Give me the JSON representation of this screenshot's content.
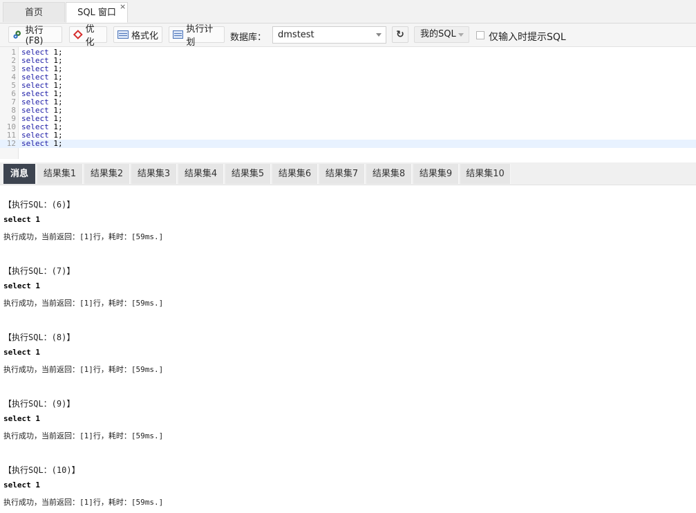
{
  "tabs": {
    "home": "首页",
    "sql": "SQL 窗口",
    "close": "×"
  },
  "toolbar": {
    "execute": "执行(F8)",
    "optimize": "优化",
    "format": "格式化",
    "plan": "执行计划",
    "db_label": "数据库：",
    "db_value": "dmstest",
    "refresh_icon": "↻",
    "my_sql": "我的SQL",
    "hint_only": "仅输入时提示SQL"
  },
  "editor": {
    "lines": [
      {
        "n": "1",
        "kw": "select",
        "rest": " 1;"
      },
      {
        "n": "2",
        "kw": "select",
        "rest": " 1;"
      },
      {
        "n": "3",
        "kw": "select",
        "rest": " 1;"
      },
      {
        "n": "4",
        "kw": "select",
        "rest": " 1;"
      },
      {
        "n": "5",
        "kw": "select",
        "rest": " 1;"
      },
      {
        "n": "6",
        "kw": "select",
        "rest": " 1;"
      },
      {
        "n": "7",
        "kw": "select",
        "rest": " 1;"
      },
      {
        "n": "8",
        "kw": "select",
        "rest": " 1;"
      },
      {
        "n": "9",
        "kw": "select",
        "rest": " 1;"
      },
      {
        "n": "10",
        "kw": "select",
        "rest": " 1;"
      },
      {
        "n": "11",
        "kw": "select",
        "rest": " 1;"
      },
      {
        "n": "12",
        "kw": "select",
        "rest": " 1;"
      }
    ]
  },
  "result_tabs": [
    "消息",
    "结果集1",
    "结果集2",
    "结果集3",
    "结果集4",
    "结果集5",
    "结果集6",
    "结果集7",
    "结果集8",
    "结果集9",
    "结果集10"
  ],
  "messages": [
    {
      "head": "【执行SQL：(6)】",
      "sql": "select 1",
      "result": "执行成功，当前返回：[1]行，耗时：[59ms.]"
    },
    {
      "head": "【执行SQL：(7)】",
      "sql": "select 1",
      "result": "执行成功，当前返回：[1]行，耗时：[59ms.]"
    },
    {
      "head": "【执行SQL：(8)】",
      "sql": "select 1",
      "result": "执行成功，当前返回：[1]行，耗时：[59ms.]"
    },
    {
      "head": "【执行SQL：(9)】",
      "sql": "select 1",
      "result": "执行成功，当前返回：[1]行，耗时：[59ms.]"
    },
    {
      "head": "【执行SQL：(10)】",
      "sql": "select 1",
      "result": "执行成功，当前返回：[1]行，耗时：[59ms.]"
    }
  ]
}
